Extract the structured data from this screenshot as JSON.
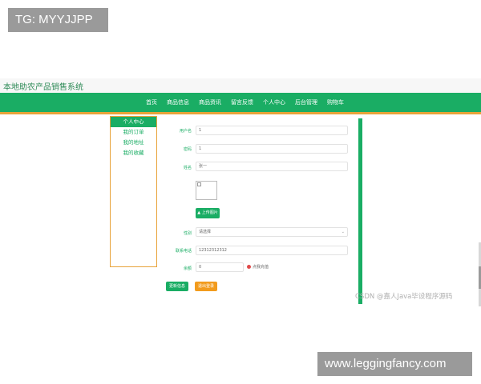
{
  "overlays": {
    "top_left_tag": "TG: MYYJJPP",
    "bottom_right_url": "www.leggingfancy.com"
  },
  "app": {
    "site_title": "本地助农产品销售系统",
    "nav": [
      "首页",
      "商品信息",
      "商品资讯",
      "留言反馈",
      "个人中心",
      "后台管理",
      "购物车"
    ],
    "sidebar": {
      "items": [
        "个人中心",
        "我的订单",
        "我的地址",
        "我的收藏"
      ],
      "active_index": 0
    },
    "form": {
      "username": {
        "label": "用户名",
        "value": "1"
      },
      "password": {
        "label": "密码",
        "value": "1"
      },
      "name": {
        "label": "姓名",
        "value": "张一"
      },
      "upload_label": "上传图片",
      "gender": {
        "label": "性别",
        "value": "请选择"
      },
      "phone": {
        "label": "联系电话",
        "value": "12312312312"
      },
      "balance": {
        "label": "余额",
        "value": "0"
      },
      "recharge_label": "点我充值",
      "update_button": "更新信息",
      "logout_button": "退出登录"
    },
    "watermark": "CSDN @嘉人Java毕设程序源码"
  },
  "colors": {
    "primary_green": "#1aad64",
    "accent_orange": "#e8a33a",
    "logout_orange": "#f29b1d"
  }
}
